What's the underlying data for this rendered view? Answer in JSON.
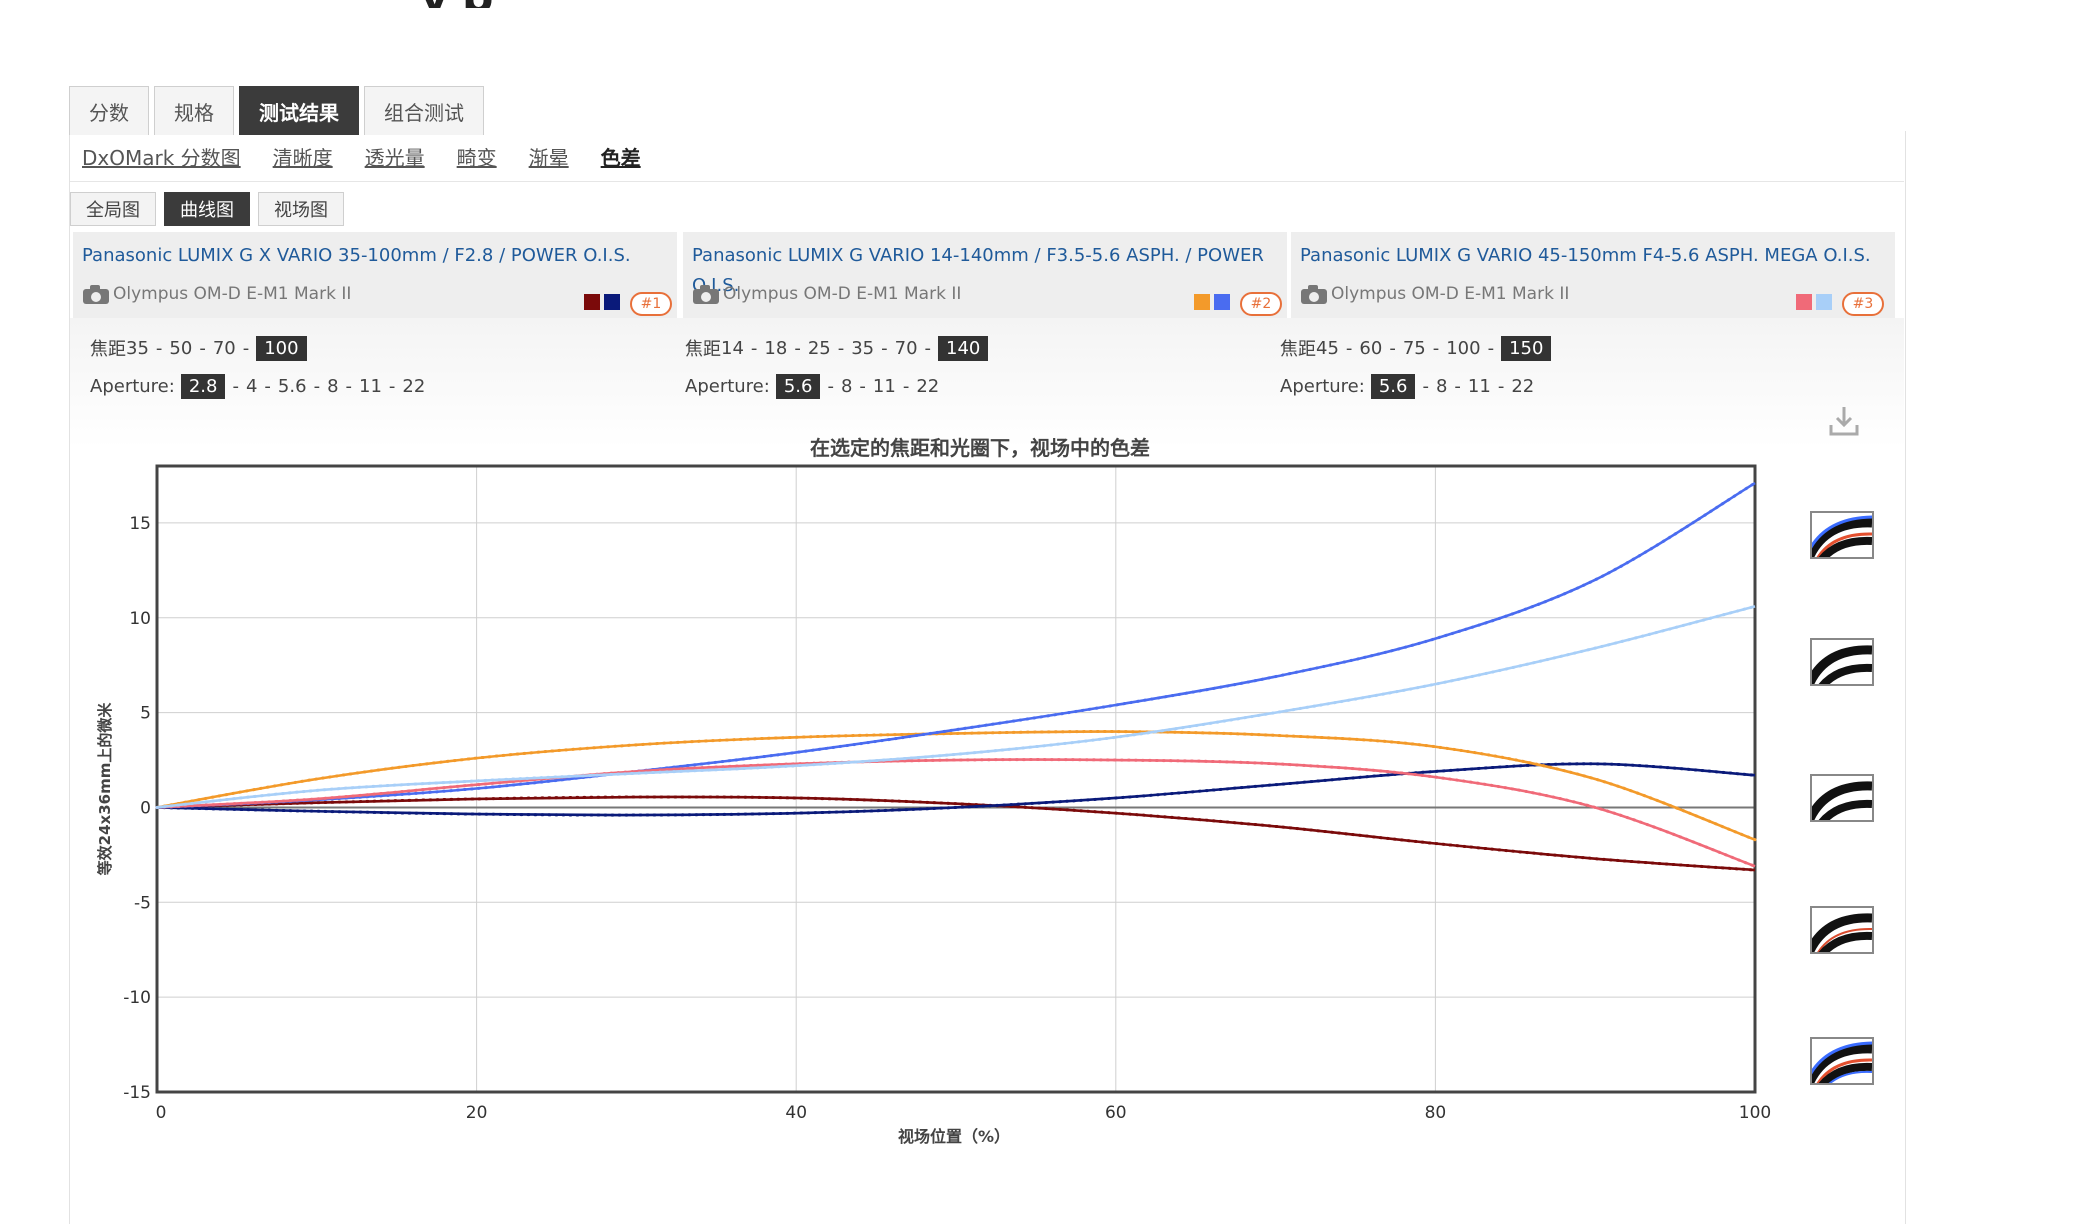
{
  "page_title_fragment": "y p",
  "tabs": [
    {
      "label": "分数",
      "active": false
    },
    {
      "label": "规格",
      "active": false
    },
    {
      "label": "测试结果",
      "active": true
    },
    {
      "label": "组合测试",
      "active": false
    }
  ],
  "subnav": [
    {
      "label": "DxOMark 分数图",
      "active": false
    },
    {
      "label": "清晰度",
      "active": false
    },
    {
      "label": "透光量",
      "active": false
    },
    {
      "label": "畸变",
      "active": false
    },
    {
      "label": "渐晕",
      "active": false
    },
    {
      "label": "色差",
      "active": true
    }
  ],
  "view_tabs": [
    {
      "label": "全局图",
      "active": false
    },
    {
      "label": "曲线图",
      "active": true
    },
    {
      "label": "视场图",
      "active": false
    }
  ],
  "lenses": [
    {
      "name": "Panasonic LUMIX G X VARIO 35-100mm / F2.8 / POWER O.I.S.",
      "camera": "Olympus OM-D E-M1 Mark II",
      "colors": [
        "#7b0a0a",
        "#0a1a7a"
      ],
      "badge": "#1",
      "focal_label": "焦距",
      "focal": [
        "35",
        "50",
        "70",
        "100"
      ],
      "focal_selected": "100",
      "aperture_label": "Aperture:",
      "apertures": [
        "2.8",
        "4",
        "5.6",
        "8",
        "11",
        "22"
      ],
      "aperture_selected": "2.8"
    },
    {
      "name": "Panasonic LUMIX G VARIO 14-140mm / F3.5-5.6 ASPH. / POWER O.I.S.",
      "camera": "Olympus OM-D E-M1 Mark II",
      "colors": [
        "#f39a2a",
        "#4a6cf0"
      ],
      "badge": "#2",
      "focal_label": "焦距",
      "focal": [
        "14",
        "18",
        "25",
        "35",
        "70",
        "140"
      ],
      "focal_selected": "140",
      "aperture_label": "Aperture:",
      "apertures": [
        "5.6",
        "8",
        "11",
        "22"
      ],
      "aperture_selected": "5.6"
    },
    {
      "name": "Panasonic LUMIX G VARIO 45-150mm F4-5.6 ASPH. MEGA O.I.S.",
      "camera": "Olympus OM-D E-M1 Mark II",
      "colors": [
        "#f06a78",
        "#a8cff8"
      ],
      "badge": "#3",
      "focal_label": "焦距",
      "focal": [
        "45",
        "60",
        "75",
        "100",
        "150"
      ],
      "focal_selected": "150",
      "aperture_label": "Aperture:",
      "apertures": [
        "5.6",
        "8",
        "11",
        "22"
      ],
      "aperture_selected": "5.6"
    }
  ],
  "icons": {
    "download": "download-icon",
    "camera": "camera-icon"
  },
  "chart_data": {
    "type": "line",
    "title": "在选定的焦距和光圈下，视场中的色差",
    "xlabel": "视场位置（%）",
    "ylabel": "等效24x36mm上的微米",
    "xlim": [
      0,
      100
    ],
    "ylim": [
      -15,
      18
    ],
    "xticks": [
      0,
      20,
      40,
      60,
      80,
      100
    ],
    "yticks": [
      -15,
      -10,
      -5,
      0,
      5,
      10,
      15
    ],
    "grid": true,
    "x": [
      0,
      10,
      20,
      30,
      40,
      50,
      60,
      70,
      80,
      90,
      100
    ],
    "series": [
      {
        "color": "#7b0a0a",
        "values": [
          0,
          0.25,
          0.45,
          0.55,
          0.5,
          0.2,
          -0.3,
          -1.0,
          -1.9,
          -2.7,
          -3.3
        ]
      },
      {
        "color": "#0a1a7a",
        "values": [
          0,
          -0.2,
          -0.35,
          -0.4,
          -0.3,
          0.0,
          0.5,
          1.2,
          1.9,
          2.3,
          1.7
        ]
      },
      {
        "color": "#f39a2a",
        "values": [
          0,
          1.5,
          2.6,
          3.3,
          3.7,
          3.9,
          4.0,
          3.8,
          3.2,
          1.5,
          -1.7
        ]
      },
      {
        "color": "#4a6cf0",
        "values": [
          0,
          0.4,
          1.0,
          1.9,
          2.9,
          4.1,
          5.4,
          6.9,
          8.9,
          12.0,
          17.1
        ]
      },
      {
        "color": "#f06a78",
        "values": [
          0,
          0.45,
          1.2,
          1.9,
          2.3,
          2.5,
          2.5,
          2.3,
          1.6,
          0.0,
          -3.1
        ]
      },
      {
        "color": "#a8cff8",
        "values": [
          0,
          0.9,
          1.4,
          1.8,
          2.2,
          2.8,
          3.7,
          5.0,
          6.5,
          8.4,
          10.6
        ]
      }
    ]
  }
}
